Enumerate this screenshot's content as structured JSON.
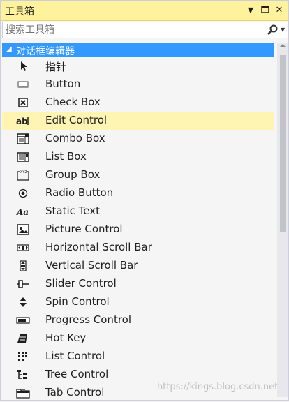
{
  "window": {
    "title": "工具箱"
  },
  "search": {
    "placeholder": "搜索工具箱",
    "value": ""
  },
  "group": {
    "label": "对话框编辑器"
  },
  "items": [
    {
      "label": "指针",
      "icon": "pointer-icon"
    },
    {
      "label": "Button",
      "icon": "button-icon"
    },
    {
      "label": "Check Box",
      "icon": "checkbox-icon"
    },
    {
      "label": "Edit Control",
      "icon": "edit-control-icon",
      "selected": true
    },
    {
      "label": "Combo Box",
      "icon": "combo-box-icon"
    },
    {
      "label": "List Box",
      "icon": "list-box-icon"
    },
    {
      "label": "Group Box",
      "icon": "group-box-icon"
    },
    {
      "label": "Radio Button",
      "icon": "radio-button-icon"
    },
    {
      "label": "Static Text",
      "icon": "static-text-icon"
    },
    {
      "label": "Picture Control",
      "icon": "picture-control-icon"
    },
    {
      "label": "Horizontal Scroll Bar",
      "icon": "horizontal-scroll-bar-icon"
    },
    {
      "label": "Vertical Scroll Bar",
      "icon": "vertical-scroll-bar-icon"
    },
    {
      "label": "Slider Control",
      "icon": "slider-control-icon"
    },
    {
      "label": "Spin Control",
      "icon": "spin-control-icon"
    },
    {
      "label": "Progress Control",
      "icon": "progress-control-icon"
    },
    {
      "label": "Hot Key",
      "icon": "hot-key-icon"
    },
    {
      "label": "List Control",
      "icon": "list-control-icon"
    },
    {
      "label": "Tree Control",
      "icon": "tree-control-icon"
    },
    {
      "label": "Tab Control",
      "icon": "tab-control-icon"
    }
  ],
  "watermark": "https://kings.blog.csdn.net",
  "colors": {
    "title_bar": "#fff29d",
    "group_header": "#3399ff",
    "selected_item": "#fff5b3"
  }
}
